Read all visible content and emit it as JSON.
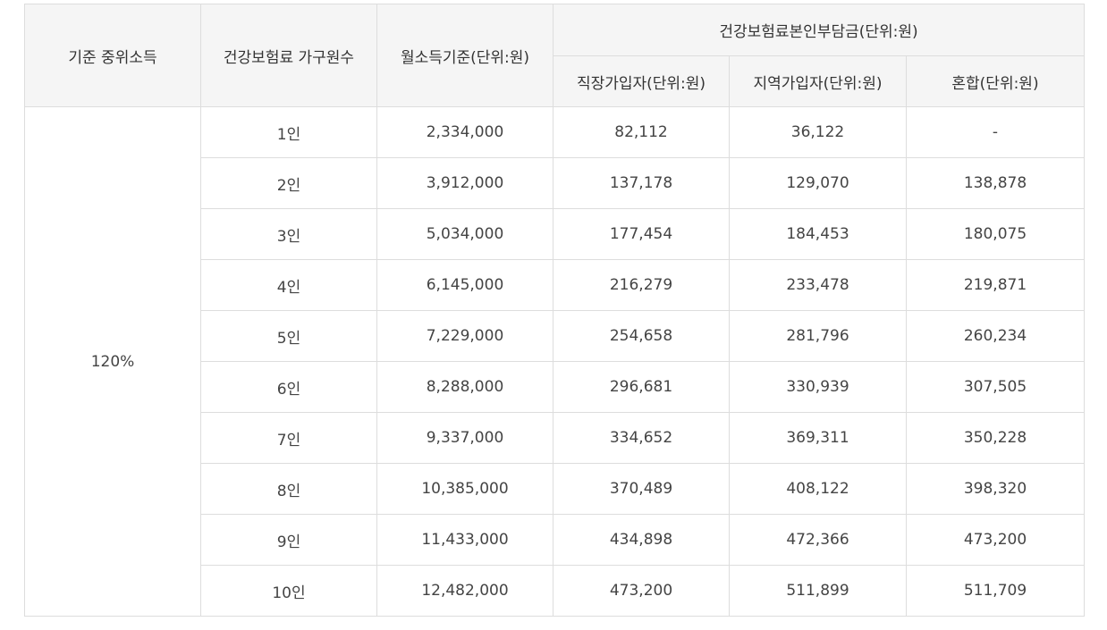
{
  "table": {
    "headers": {
      "median_income": "기준 중위소득",
      "household_size": "건강보험료 가구원수",
      "monthly_income": "월소득기준(단위:원)",
      "premium_group": "건강보험료본인부담금(단위:원)",
      "employee": "직장가입자(단위:원)",
      "regional": "지역가입자(단위:원)",
      "mixed": "혼합(단위:원)"
    },
    "median_income_value": "120%",
    "rows": [
      {
        "household": "1인",
        "income": "2,334,000",
        "employee": "82,112",
        "regional": "36,122",
        "mixed": "-"
      },
      {
        "household": "2인",
        "income": "3,912,000",
        "employee": "137,178",
        "regional": "129,070",
        "mixed": "138,878"
      },
      {
        "household": "3인",
        "income": "5,034,000",
        "employee": "177,454",
        "regional": "184,453",
        "mixed": "180,075"
      },
      {
        "household": "4인",
        "income": "6,145,000",
        "employee": "216,279",
        "regional": "233,478",
        "mixed": "219,871"
      },
      {
        "household": "5인",
        "income": "7,229,000",
        "employee": "254,658",
        "regional": "281,796",
        "mixed": "260,234"
      },
      {
        "household": "6인",
        "income": "8,288,000",
        "employee": "296,681",
        "regional": "330,939",
        "mixed": "307,505"
      },
      {
        "household": "7인",
        "income": "9,337,000",
        "employee": "334,652",
        "regional": "369,311",
        "mixed": "350,228"
      },
      {
        "household": "8인",
        "income": "10,385,000",
        "employee": "370,489",
        "regional": "408,122",
        "mixed": "398,320"
      },
      {
        "household": "9인",
        "income": "11,433,000",
        "employee": "434,898",
        "regional": "472,366",
        "mixed": "473,200"
      },
      {
        "household": "10인",
        "income": "12,482,000",
        "employee": "473,200",
        "regional": "511,899",
        "mixed": "511,709"
      }
    ]
  }
}
